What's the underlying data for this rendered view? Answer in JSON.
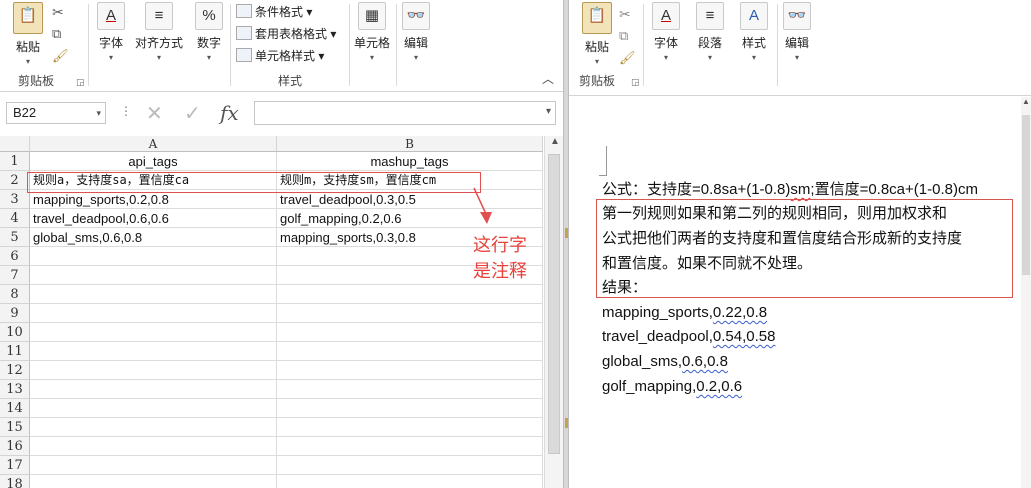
{
  "excel": {
    "ribbon": {
      "paste": "粘贴",
      "clipboard_group": "剪贴板",
      "font": "字体",
      "alignment": "对齐方式",
      "number": "数字",
      "conditional_format": "条件格式",
      "table_format": "套用表格格式",
      "cell_style": "单元格样式",
      "styles_group": "样式",
      "cells": "单元格",
      "editing": "编辑",
      "percent_glyph": "%"
    },
    "formula_bar": {
      "name_box": "B22",
      "fx": "fx",
      "value": ""
    },
    "columns": [
      "A",
      "B"
    ],
    "rows": [
      {
        "num": "1",
        "a": "api_tags",
        "b": "mashup_tags"
      },
      {
        "num": "2",
        "a": "规则a，支持度sa，置信度ca",
        "b": "规则m，支持度sm，置信度cm"
      },
      {
        "num": "3",
        "a": "mapping_sports,0.2,0.8",
        "b": "travel_deadpool,0.3,0.5"
      },
      {
        "num": "4",
        "a": "travel_deadpool,0.6,0.6",
        "b": "golf_mapping,0.2,0.6"
      },
      {
        "num": "5",
        "a": "global_sms,0.6,0.8",
        "b": "mapping_sports,0.3,0.8"
      },
      {
        "num": "6",
        "a": "",
        "b": ""
      },
      {
        "num": "7",
        "a": "",
        "b": ""
      },
      {
        "num": "8",
        "a": "",
        "b": ""
      },
      {
        "num": "9",
        "a": "",
        "b": ""
      },
      {
        "num": "10",
        "a": "",
        "b": ""
      },
      {
        "num": "11",
        "a": "",
        "b": ""
      },
      {
        "num": "12",
        "a": "",
        "b": ""
      },
      {
        "num": "13",
        "a": "",
        "b": ""
      },
      {
        "num": "14",
        "a": "",
        "b": ""
      },
      {
        "num": "15",
        "a": "",
        "b": ""
      },
      {
        "num": "16",
        "a": "",
        "b": ""
      },
      {
        "num": "17",
        "a": "",
        "b": ""
      },
      {
        "num": "18",
        "a": "",
        "b": ""
      }
    ],
    "annotation": {
      "line1": "这行字",
      "line2": "是注释",
      "color": "#e8403a"
    }
  },
  "word": {
    "ribbon": {
      "paste": "粘贴",
      "clipboard_group": "剪贴板",
      "font": "字体",
      "paragraph": "段落",
      "styles": "样式",
      "editing": "编辑"
    },
    "document": {
      "formula_prefix": "公式：支持度=0.8sa+(1-0.8)",
      "formula_sm": "sm",
      "formula_rest": ";置信度=0.8ca+(1-0.8)cm",
      "rule_line1": "第一列规则如果和第二列的规则相同，则用加权求和",
      "rule_line2": "公式把他们两者的支持度和置信度结合形成新的支持度",
      "rule_line3": "和置信度。如果不同就不处理。",
      "result_label": "结果：",
      "results": [
        {
          "name": "mapping_sports,",
          "vals": "0.22,0.8"
        },
        {
          "name": "travel_deadpool,",
          "vals": "0.54,0.58"
        },
        {
          "name": "global_sms,",
          "vals": "0.6,0.8"
        },
        {
          "name": "golf_mapping,",
          "vals": "0.2,0.6"
        }
      ]
    }
  },
  "icons": [
    "paste-icon",
    "cut-icon",
    "copy-icon",
    "format-painter-icon",
    "font-icon",
    "align-icon",
    "percent-icon",
    "cells-icon",
    "binoculars-icon",
    "cancel-icon",
    "check-icon",
    "fx-icon",
    "styles-icon",
    "paragraph-icon"
  ]
}
